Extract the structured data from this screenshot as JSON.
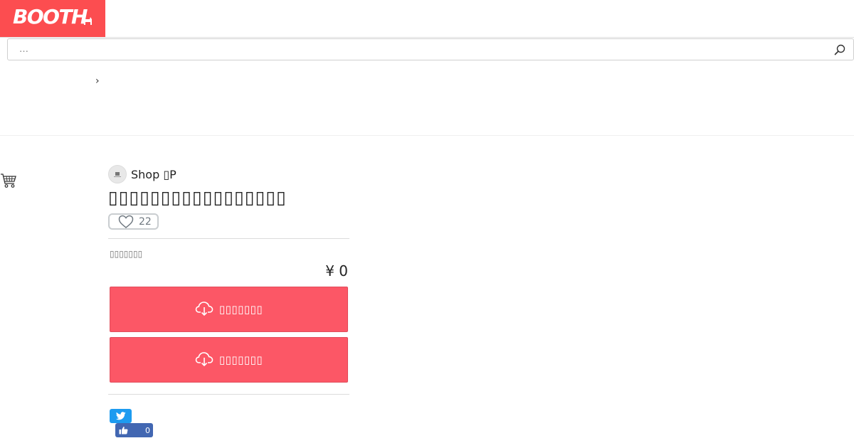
{
  "header": {
    "logo_text": "BOOTH",
    "search": {
      "placeholder": "…",
      "value": ""
    }
  },
  "breadcrumb": {
    "separator": "›"
  },
  "product": {
    "shop_name": "Shop ▯P",
    "title": "▯▯▯▯▯▯▯▯▯▯▯▯▯▯▯▯▯",
    "likes": "22",
    "variation_label": "▯▯▯▯▯▯▯",
    "price": "¥ 0",
    "buttons": [
      {
        "label": "▯▯▯▯▯▯▯"
      },
      {
        "label": "▯▯▯▯▯▯▯"
      }
    ]
  },
  "social": {
    "facebook_count": "0"
  },
  "icons": {
    "logo_mascot": "dog-icon",
    "search": "search-icon",
    "cart": "cart-icon",
    "heart": "heart-icon",
    "download": "cloud-download-icon",
    "twitter": "twitter-icon",
    "facebook": "thumbs-up-icon"
  },
  "colors": {
    "brand": "#fc4d50",
    "button": "#fc5766",
    "twitter": "#1d9bf0",
    "facebook": "#4267b2"
  }
}
